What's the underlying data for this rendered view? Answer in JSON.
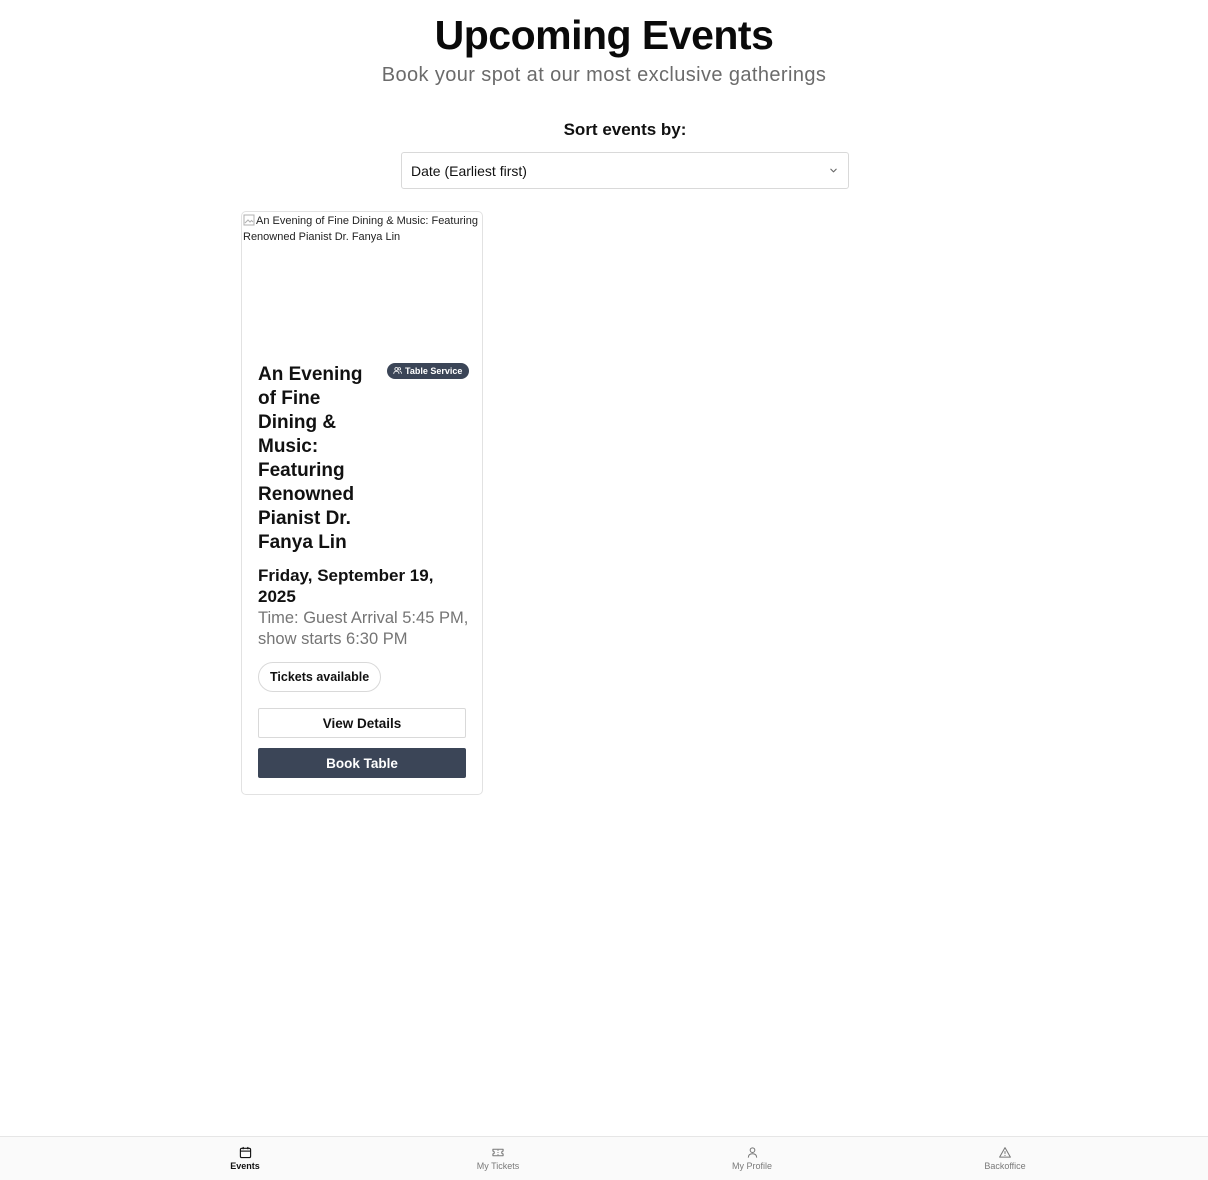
{
  "header": {
    "title": "Upcoming Events",
    "subtitle": "Book your spot at our most exclusive gatherings"
  },
  "sort": {
    "label": "Sort events by:",
    "selected": "Date (Earliest first)",
    "icon": "chevron-down-icon"
  },
  "events": [
    {
      "image_alt": "An Evening of Fine Dining & Music: Featuring Renowned Pianist Dr. Fanya Lin",
      "badge": "Table Service",
      "title": "An Evening of Fine Dining & Music: Featuring Renowned Pianist Dr. Fanya Lin",
      "date": "Friday, September 19, 2025",
      "time": "Time: Guest Arrival 5:45 PM, show starts 6:30 PM",
      "status": "Tickets available",
      "details_label": "View Details",
      "book_label": "Book Table"
    }
  ],
  "nav": {
    "items": [
      {
        "label": "Events",
        "icon": "calendar-icon",
        "active": true
      },
      {
        "label": "My Tickets",
        "icon": "ticket-icon",
        "active": false
      },
      {
        "label": "My Profile",
        "icon": "user-icon",
        "active": false
      },
      {
        "label": "Backoffice",
        "icon": "warning-triangle-icon",
        "active": false
      }
    ]
  },
  "colors": {
    "accent": "#3b4557",
    "muted_text": "#757575",
    "border": "#d9d9d9"
  }
}
